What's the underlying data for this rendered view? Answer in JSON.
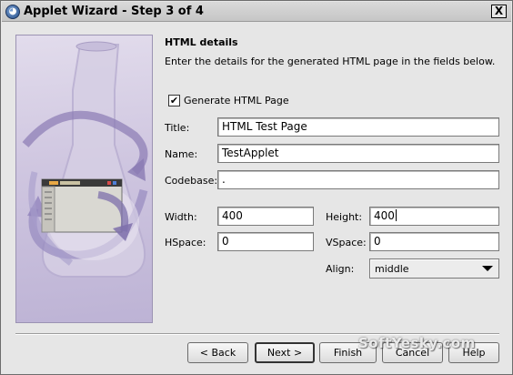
{
  "window": {
    "title": "Applet Wizard - Step 3 of 4",
    "close_glyph": "X"
  },
  "header": {
    "heading": "HTML details",
    "description": "Enter the details for the generated HTML page in the fields below."
  },
  "generate_html": {
    "label": "Generate HTML Page",
    "checked": true,
    "check_glyph": "✔"
  },
  "fields": {
    "title": {
      "label": "Title:",
      "value": "HTML Test Page"
    },
    "name": {
      "label": "Name:",
      "value": "TestApplet"
    },
    "codebase": {
      "label": "Codebase:",
      "value": "."
    },
    "width": {
      "label": "Width:",
      "value": "400"
    },
    "height": {
      "label": "Height:",
      "value": "400"
    },
    "hspace": {
      "label": "HSpace:",
      "value": "0"
    },
    "vspace": {
      "label": "VSpace:",
      "value": "0"
    },
    "align": {
      "label": "Align:",
      "value": "middle"
    }
  },
  "buttons": {
    "back": "< Back",
    "next": "Next >",
    "finish": "Finish",
    "cancel": "Cancel",
    "help": "Help"
  },
  "watermark": "SoftYesky.com",
  "colors": {
    "panel_purple": "#c9bfdc",
    "titlebar": "#d0d0d0"
  }
}
